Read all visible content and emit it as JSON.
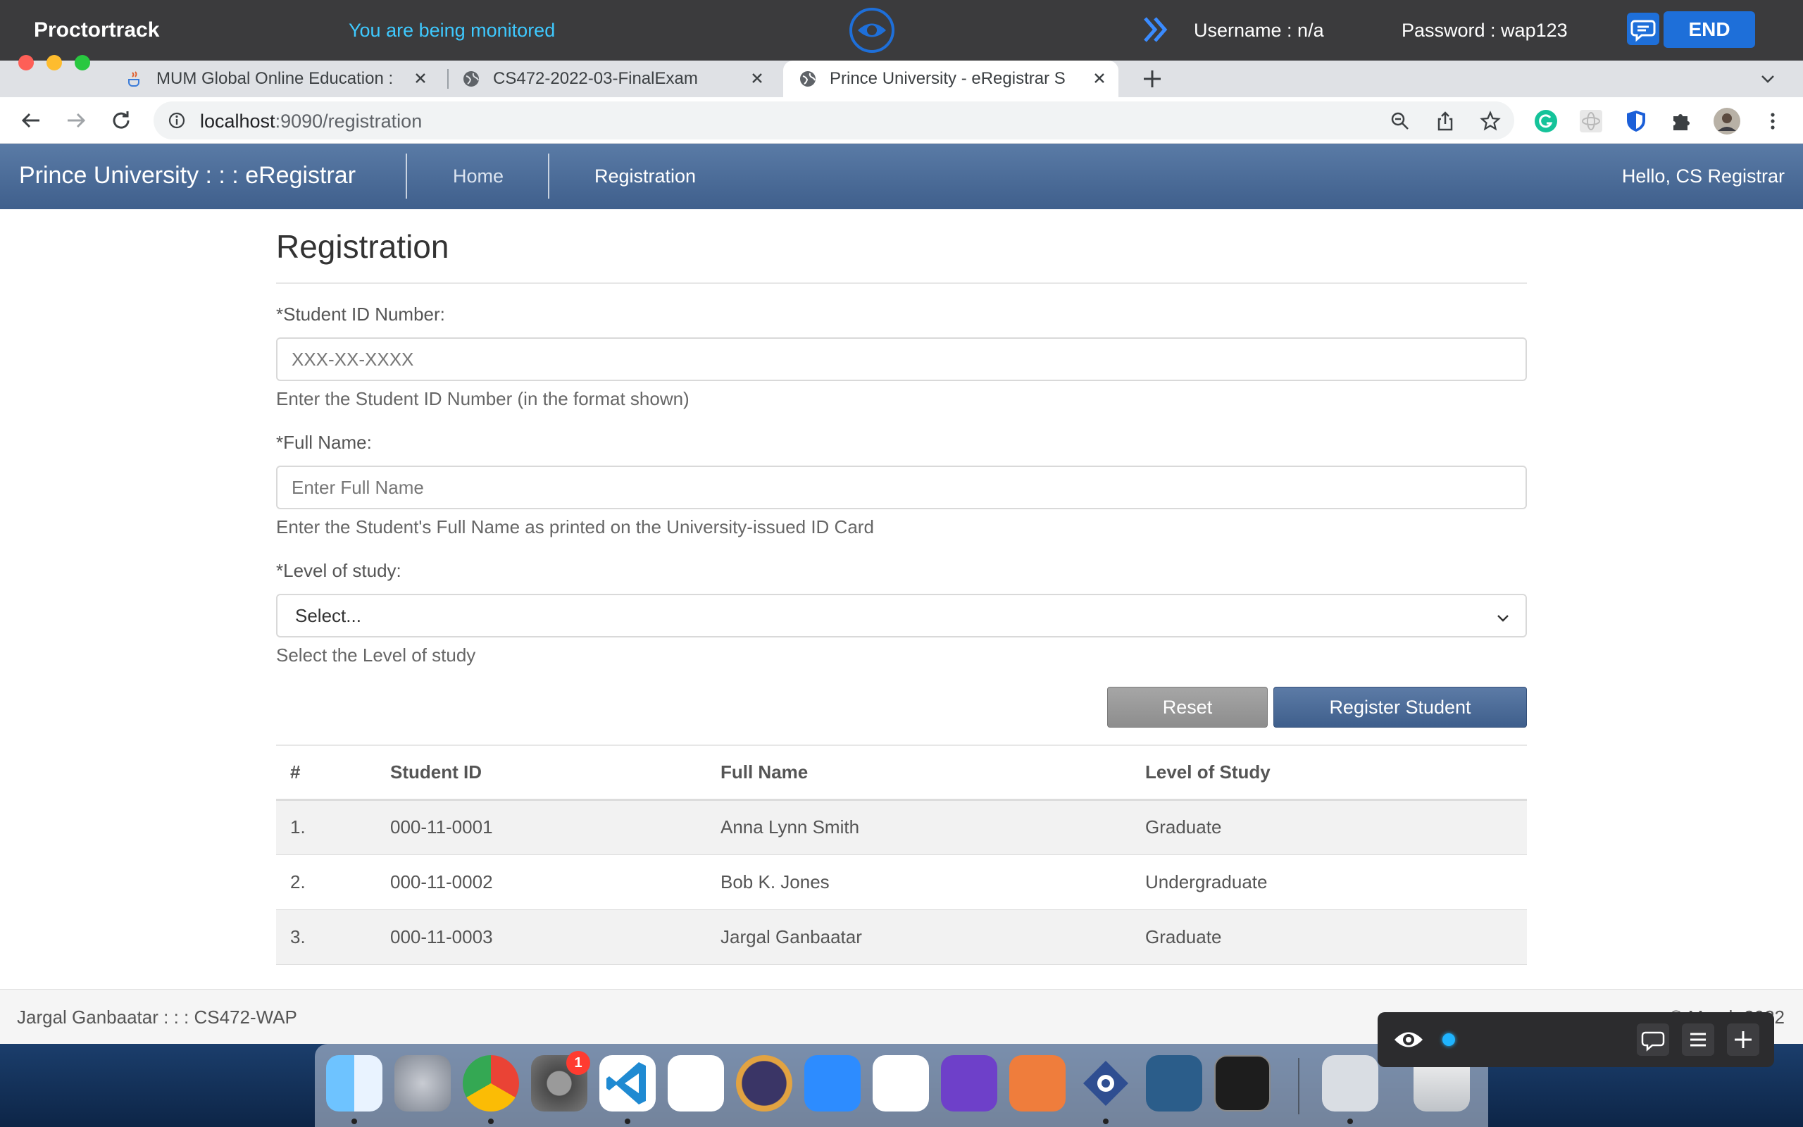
{
  "proctor": {
    "brand": "Proctortrack",
    "status": "You are being monitored",
    "username": "Username : n/a",
    "password": "Password : wap123",
    "end_label": "END"
  },
  "browser": {
    "tabs": [
      {
        "title": "MUM Global Online Education :",
        "icon": "java-cup-icon"
      },
      {
        "title": "CS472-2022-03-FinalExam",
        "icon": "globe-icon"
      },
      {
        "title": "Prince University - eRegistrar S",
        "icon": "globe-icon",
        "active": true
      }
    ],
    "url_host": "localhost",
    "url_rest": ":9090/registration"
  },
  "navbar": {
    "brand": "Prince University : : : eRegistrar",
    "links": [
      "Home",
      "Registration"
    ],
    "greeting": "Hello, CS Registrar"
  },
  "form": {
    "title": "Registration",
    "student_id": {
      "label": "*Student ID Number:",
      "placeholder": "XXX-XX-XXXX",
      "help": "Enter the Student ID Number (in the format shown)"
    },
    "full_name": {
      "label": "*Full Name:",
      "placeholder": "Enter Full Name",
      "help": "Enter the Student's Full Name as printed on the University-issued ID Card"
    },
    "level": {
      "label": "*Level of study:",
      "selected": "Select...",
      "help": "Select the Level of study"
    },
    "reset_label": "Reset",
    "submit_label": "Register Student"
  },
  "table": {
    "headers": [
      "#",
      "Student ID",
      "Full Name",
      "Level of Study"
    ],
    "rows": [
      {
        "num": "1.",
        "id": "000-11-0001",
        "name": "Anna Lynn Smith",
        "level": "Graduate"
      },
      {
        "num": "2.",
        "id": "000-11-0002",
        "name": "Bob K. Jones",
        "level": "Undergraduate"
      },
      {
        "num": "3.",
        "id": "000-11-0003",
        "name": "Jargal Ganbaatar",
        "level": "Graduate"
      }
    ]
  },
  "footer": {
    "left": "Jargal Ganbaatar : : : CS472-WAP",
    "right": "© March 2022"
  },
  "dock": {
    "apps": [
      "finder-icon",
      "launchpad-icon",
      "chrome-icon",
      "system-preferences-icon",
      "vscode-icon",
      "android-studio-icon",
      "eclipse-icon",
      "zoom-icon",
      "teams-icon",
      "github-desktop-icon",
      "postman-icon",
      "proctortrack-icon",
      "mysql-workbench-icon",
      "terminal-icon",
      "preview-icon",
      "trash-icon"
    ],
    "badge": "1"
  },
  "colors": {
    "navbar": "#4a6b98",
    "primary_button": "#4a6b98",
    "proctor_bar": "#3b3b3d",
    "monitored_text": "#3ec9ff",
    "end_button": "#1e6fd9"
  }
}
